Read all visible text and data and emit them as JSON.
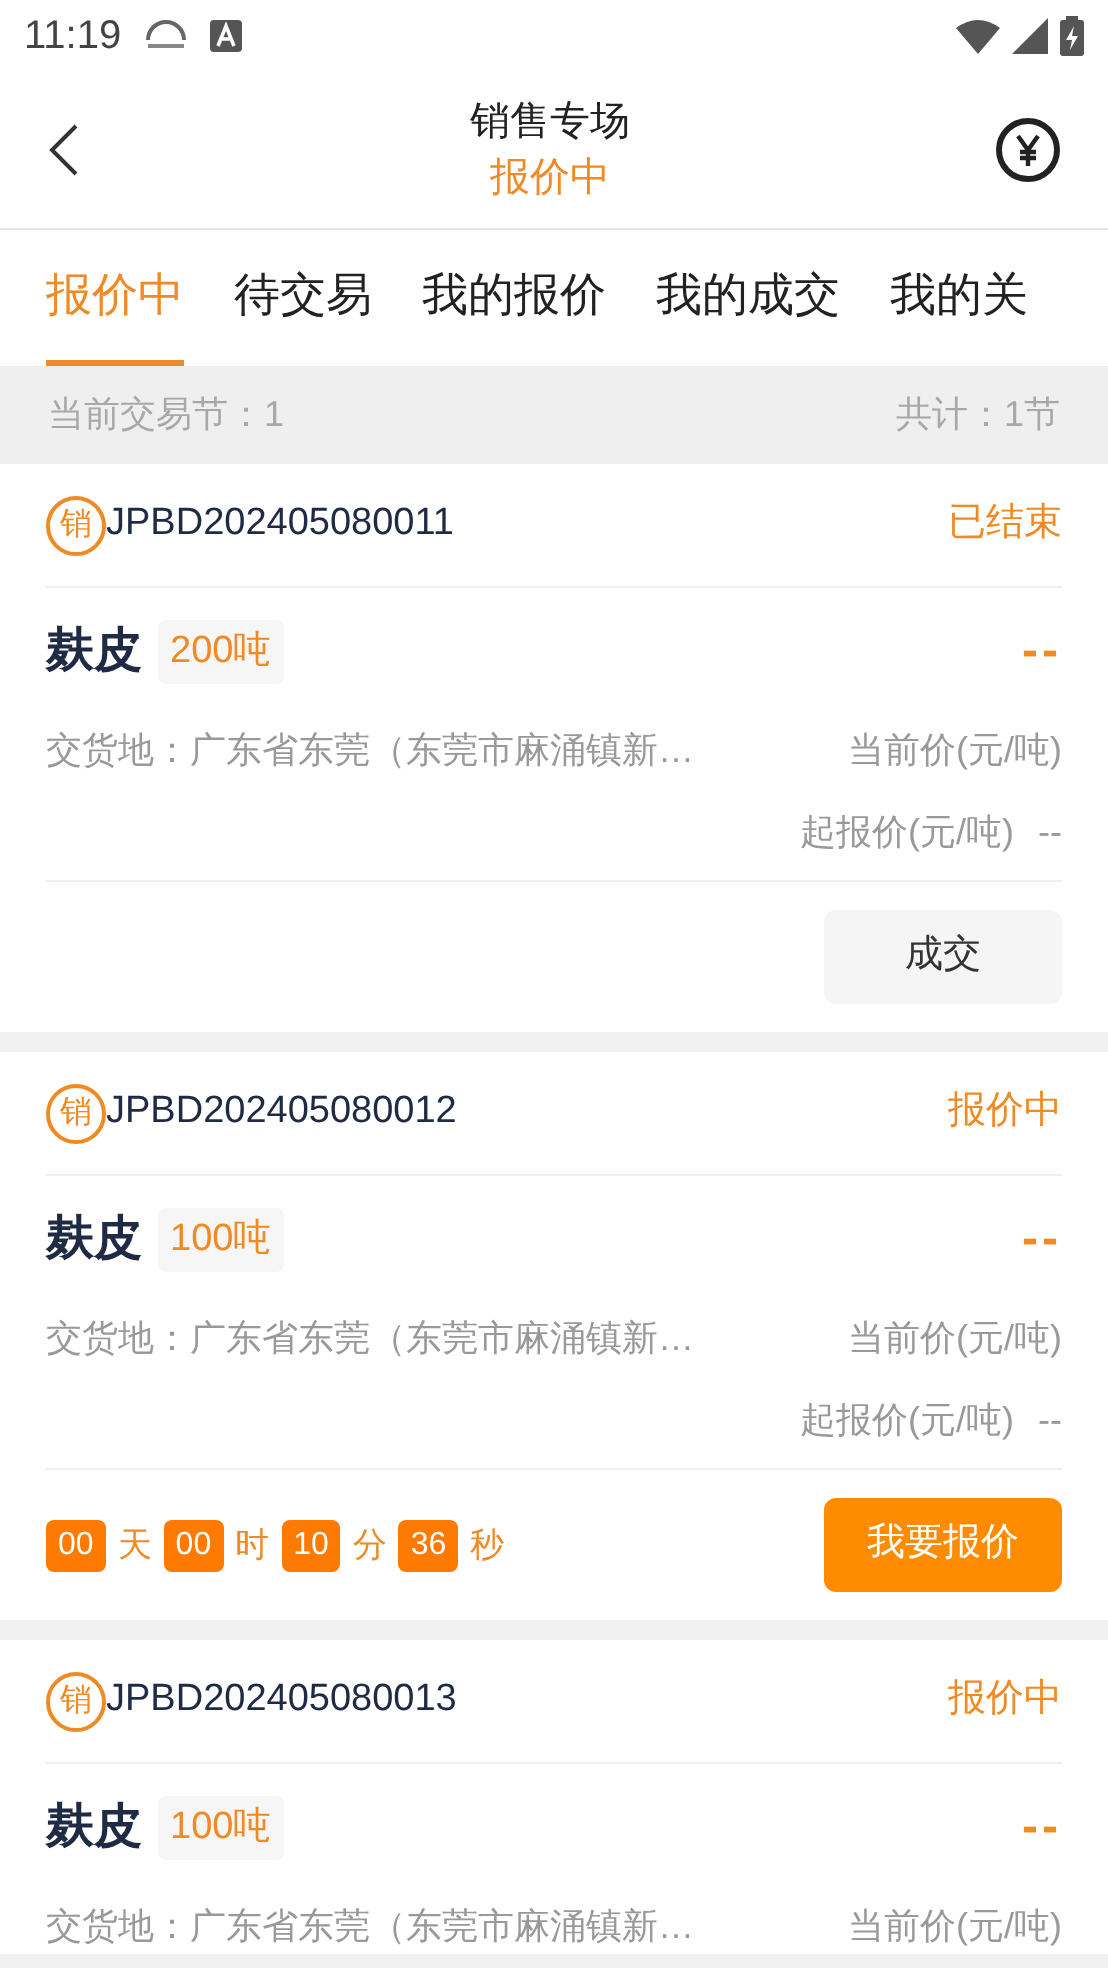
{
  "status_bar": {
    "time": "11:19"
  },
  "header": {
    "title": "销售专场",
    "subtitle": "报价中"
  },
  "tabs": [
    {
      "label": "报价中",
      "selected": true
    },
    {
      "label": "待交易",
      "selected": false
    },
    {
      "label": "我的报价",
      "selected": false
    },
    {
      "label": "我的成交",
      "selected": false
    },
    {
      "label": "我的关",
      "selected": false
    }
  ],
  "info_bar": {
    "left": "当前交易节：1",
    "right": "共计：1节"
  },
  "lots": [
    {
      "badge": "销",
      "code": "JPBD202405080011",
      "status": "已结束",
      "product": "麸皮",
      "quantity": "200吨",
      "price": "--",
      "location": "交货地：广东省东莞（东莞市麻涌镇新…",
      "current_price_label": "当前价(元/吨)",
      "start_price_label": "起报价(元/吨)",
      "start_price": "--",
      "action": {
        "label": "成交",
        "kind": "plain"
      }
    },
    {
      "badge": "销",
      "code": "JPBD202405080012",
      "status": "报价中",
      "product": "麸皮",
      "quantity": "100吨",
      "price": "--",
      "location": "交货地：广东省东莞（东莞市麻涌镇新…",
      "current_price_label": "当前价(元/吨)",
      "start_price_label": "起报价(元/吨)",
      "start_price": "--",
      "countdown": [
        {
          "value": "00",
          "unit": "天"
        },
        {
          "value": "00",
          "unit": "时"
        },
        {
          "value": "10",
          "unit": "分"
        },
        {
          "value": "36",
          "unit": "秒"
        }
      ],
      "action": {
        "label": "我要报价",
        "kind": "primary"
      }
    },
    {
      "badge": "销",
      "code": "JPBD202405080013",
      "status": "报价中",
      "product": "麸皮",
      "quantity": "100吨",
      "price": "--",
      "location": "交货地：广东省东莞（东莞市麻涌镇新…",
      "current_price_label": "当前价(元/吨)"
    }
  ]
}
